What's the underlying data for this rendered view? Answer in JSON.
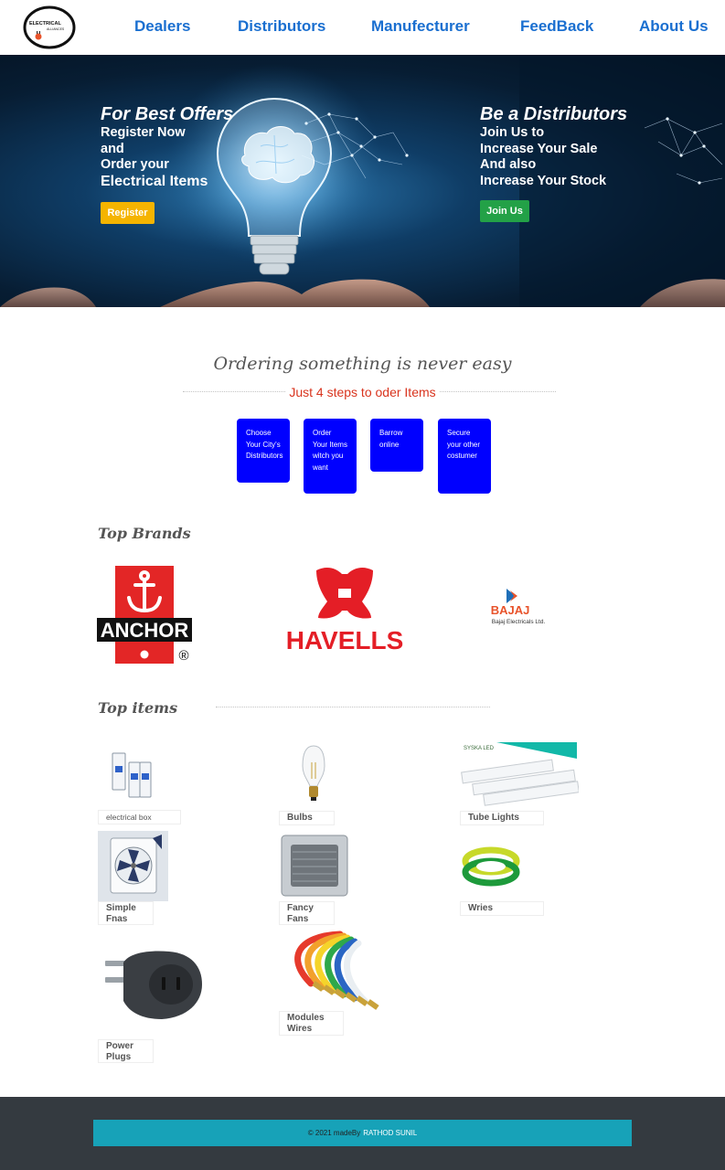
{
  "header": {
    "logo_text": "ELECTRICAL ALLIANCES",
    "nav": [
      "Dealers",
      "Distributors",
      "Manufecturer",
      "FeedBack",
      "About Us"
    ]
  },
  "hero": {
    "left": {
      "title": "For Best Offers",
      "lines": [
        "Register Now",
        "and",
        "Order your"
      ],
      "highlight": "Electrical Items",
      "button": "Register"
    },
    "right": {
      "title": "Be a Distributors",
      "lines": [
        "Join Us to",
        "Increase Your Sale",
        "And also",
        "Increase Your Stock"
      ],
      "button": "Join Us"
    }
  },
  "steps": {
    "title": "Ordering something is never easy",
    "subtitle": "Just 4 steps to oder Items",
    "items": [
      "Choose Your City's Distributors",
      "Order Your Items witch you want",
      "Barrow online",
      "Secure your other costumer"
    ]
  },
  "brands": {
    "title": "Top Brands",
    "items": [
      {
        "name": "ANCHOR",
        "mark": "®"
      },
      {
        "name": "HAVELLS"
      },
      {
        "name": "BAJAJ",
        "tagline": "Bajaj Electricals Ltd."
      }
    ]
  },
  "items": {
    "title": "Top items",
    "list": [
      {
        "label": "electrical box",
        "icon": "circuit-breaker-icon"
      },
      {
        "label": "Bulbs",
        "icon": "bulb-icon"
      },
      {
        "label": "Tube Lights",
        "icon": "tube-light-icon",
        "brand": "SYSKA LED"
      },
      {
        "label": "Simple Fnas",
        "icon": "fan-icon"
      },
      {
        "label": "Fancy Fans",
        "icon": "exhaust-fan-icon"
      },
      {
        "label": "Wries",
        "icon": "wire-coil-icon"
      },
      {
        "label": "Power Plugs",
        "icon": "plug-adapter-icon"
      },
      {
        "label": "Modules Wires",
        "icon": "wires-icon"
      }
    ]
  },
  "footer": {
    "text": "© 2021 madeBy",
    "author": "RATHOD SUNIL"
  },
  "colors": {
    "nav": "#1a6fd0",
    "register": "#f5b400",
    "join": "#23a147",
    "step": "#0000ff",
    "subtitle": "#d9341e",
    "footer": "#343a40",
    "footer_bar": "#17a2b8"
  }
}
